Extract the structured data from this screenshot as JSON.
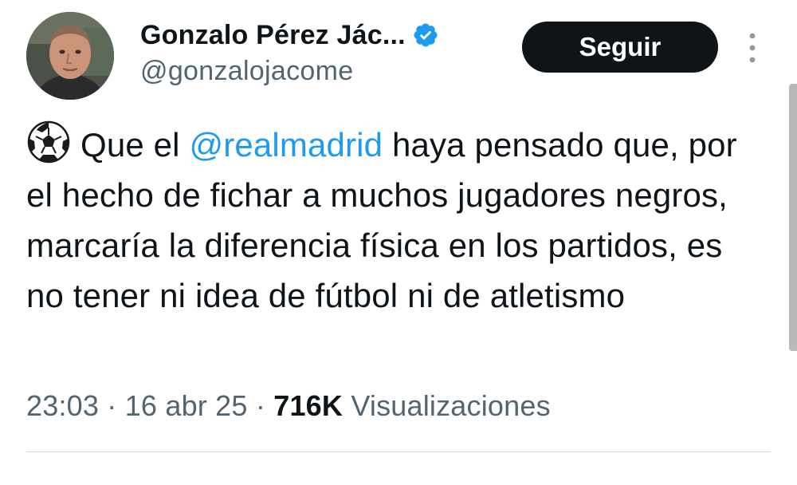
{
  "author": {
    "display_name": "Gonzalo Pérez Jác...",
    "handle": "@gonzalojacome",
    "verified_color": "#1d9bf0"
  },
  "follow_button": {
    "label": "Seguir"
  },
  "icons": {
    "avatar": "profile-photo",
    "verified": "verified-badge-icon",
    "more": "vertical-dots-icon",
    "emoji": "soccer-ball-icon"
  },
  "tweet": {
    "mention": "@realmadrid",
    "text_before": "Que el ",
    "text_after": " haya pensado que, por el hecho de fichar a muchos jugadores negros, marcaría la diferencia física en los partidos, es no tener ni idea de fútbol ni de atletismo"
  },
  "meta": {
    "time": "23:03",
    "separator": "·",
    "date": "16 abr 25",
    "views_count": "716K",
    "views_label": "Visualizaciones"
  },
  "colors": {
    "text_primary": "#0f1419",
    "text_secondary": "#536471",
    "link": "#1d9bf0",
    "button_bg": "#0f1419"
  }
}
